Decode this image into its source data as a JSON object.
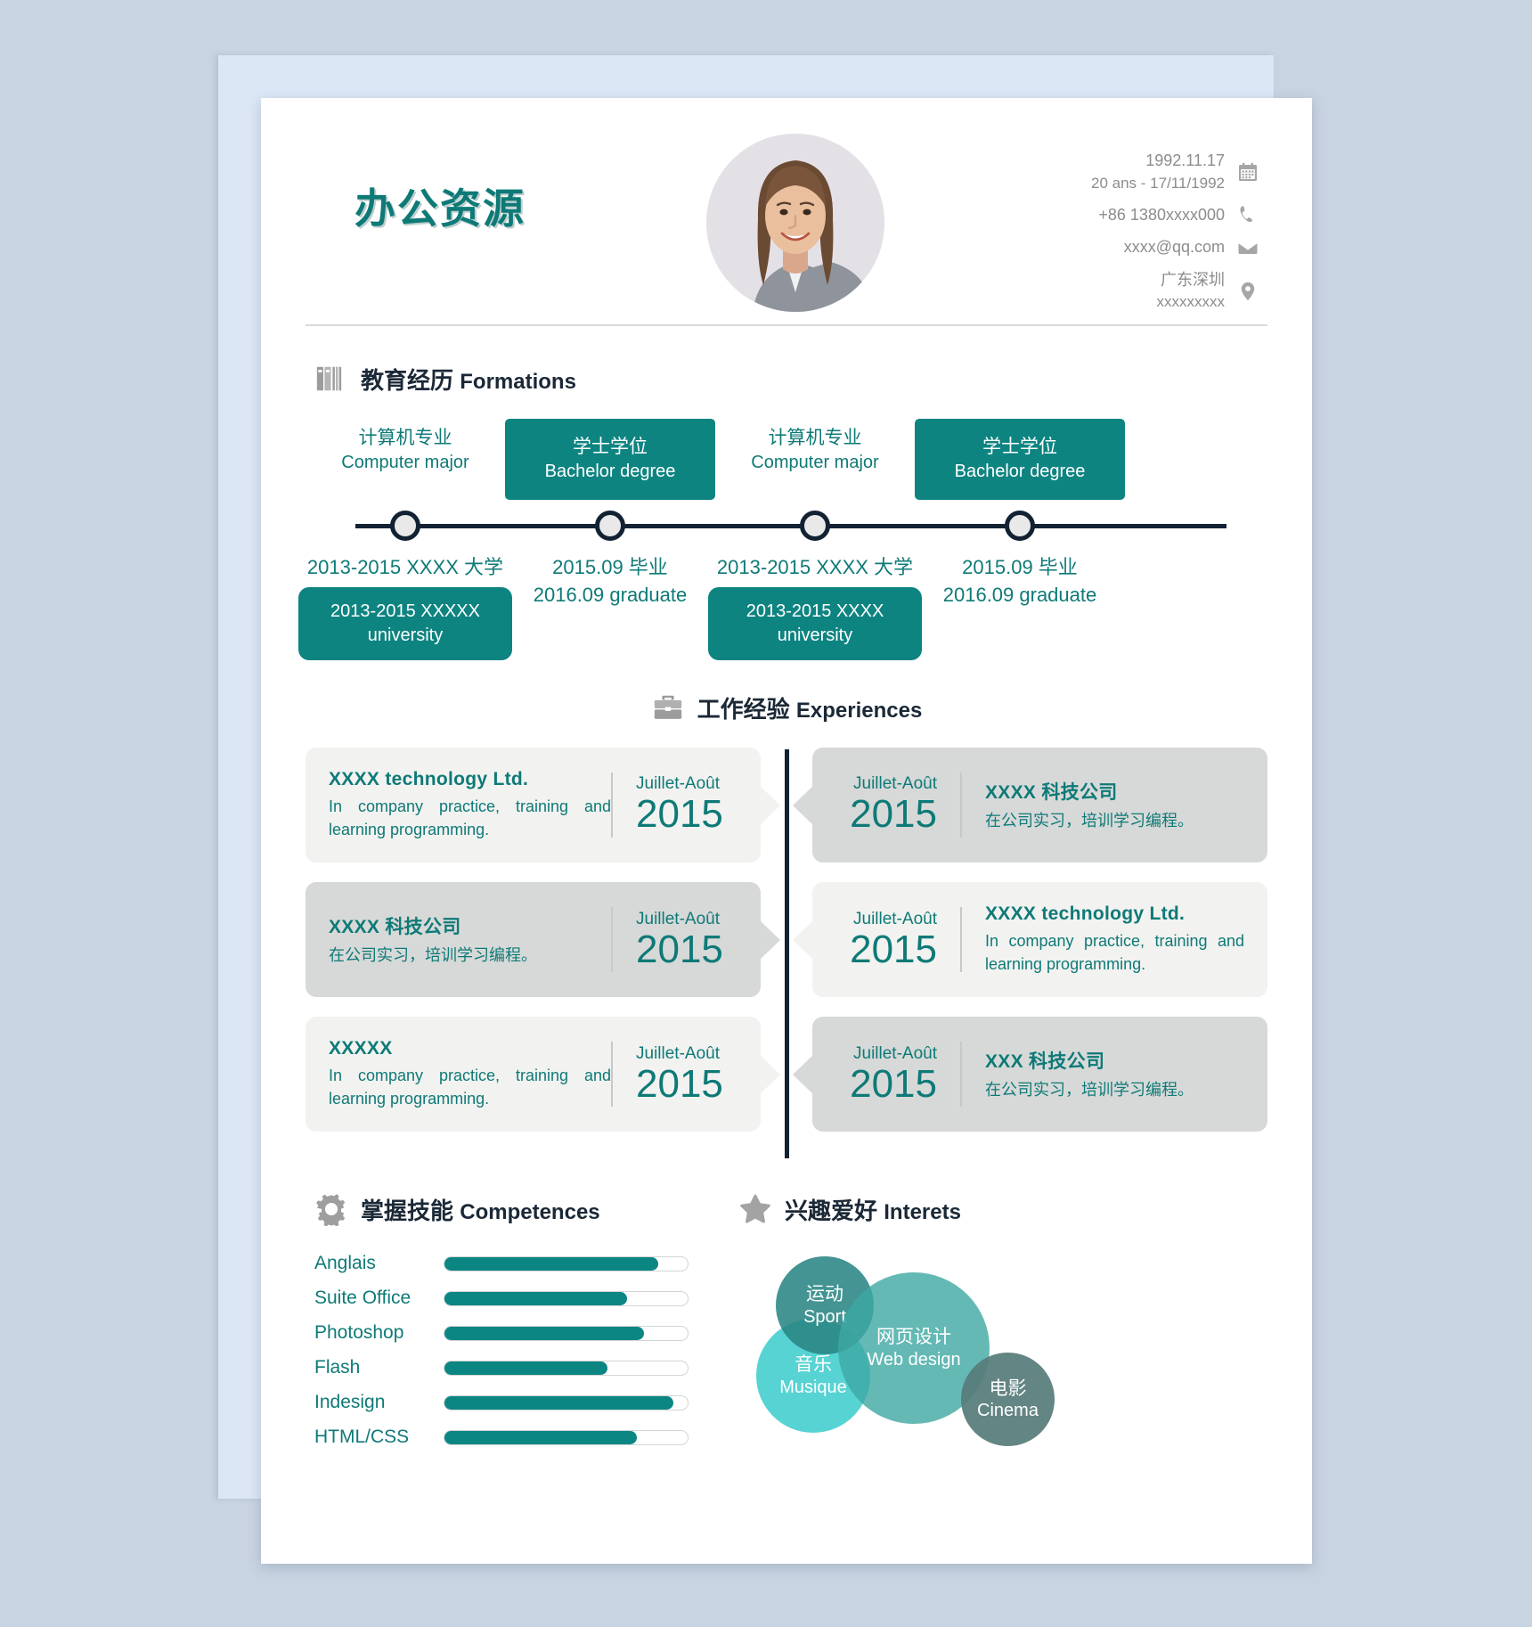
{
  "header": {
    "name": "办公资源",
    "contact": [
      {
        "icon": "calendar-icon",
        "line1": "1992.11.17",
        "line2": "20 ans - 17/11/1992"
      },
      {
        "icon": "phone-icon",
        "line1": "+86 1380xxxx000",
        "line2": ""
      },
      {
        "icon": "mail-icon",
        "line1": "xxxx@qq.com",
        "line2": ""
      },
      {
        "icon": "location-icon",
        "line1": "广东深圳",
        "line2": "xxxxxxxxx"
      }
    ]
  },
  "education": {
    "icon": "books-icon",
    "title_cn": "教育经历",
    "title_en": "Formations",
    "items": [
      {
        "top_cn": "计算机专业",
        "top_en": "Computer major",
        "boxed": false,
        "bot_line1": "2013-2015 XXXX 大学",
        "bot_line2": "",
        "pill": "2013-2015 XXXXX university"
      },
      {
        "top_cn": "学士学位",
        "top_en": "Bachelor degree",
        "boxed": true,
        "bot_line1": "2015.09 毕业",
        "bot_line2": "2016.09 graduate",
        "pill": ""
      },
      {
        "top_cn": "计算机专业",
        "top_en": "Computer major",
        "boxed": false,
        "bot_line1": "2013-2015 XXXX 大学",
        "bot_line2": "",
        "pill": "2013-2015 XXXX university"
      },
      {
        "top_cn": "学士学位",
        "top_en": "Bachelor degree",
        "boxed": true,
        "bot_line1": "2015.09 毕业",
        "bot_line2": "2016.09 graduate",
        "pill": ""
      }
    ]
  },
  "experience": {
    "icon": "briefcase-icon",
    "title_cn": "工作经验",
    "title_en": "Experiences",
    "rows": [
      {
        "left": {
          "title": "XXXX   technology Ltd.",
          "desc": "In company practice, training and learning programming.",
          "month": "Juillet-Août",
          "year": "2015",
          "tone": "light"
        },
        "right": {
          "title": "XXXX 科技公司",
          "desc": "在公司实习，培训学习编程。",
          "month": "Juillet-Août",
          "year": "2015",
          "tone": "dark"
        }
      },
      {
        "left": {
          "title": "XXXX 科技公司",
          "desc": "在公司实习，培训学习编程。",
          "month": "Juillet-Août",
          "year": "2015",
          "tone": "dark"
        },
        "right": {
          "title": "XXXX technology Ltd.",
          "desc": "In company practice, training and learning programming.",
          "month": "Juillet-Août",
          "year": "2015",
          "tone": "light"
        }
      },
      {
        "left": {
          "title": "XXXXX",
          "desc": "In company practice, training and learning programming.",
          "month": "Juillet-Août",
          "year": "2015",
          "tone": "light"
        },
        "right": {
          "title": "XXX 科技公司",
          "desc": "在公司实习，培训学习编程。",
          "month": "Juillet-Août",
          "year": "2015",
          "tone": "dark"
        }
      }
    ]
  },
  "skills": {
    "icon": "gear-icon",
    "title_cn": "掌握技能",
    "title_en": "Competences",
    "items": [
      {
        "label": "Anglais",
        "value": 88
      },
      {
        "label": "Suite Office",
        "value": 75
      },
      {
        "label": "Photoshop",
        "value": 82
      },
      {
        "label": "Flash",
        "value": 67
      },
      {
        "label": "Indesign",
        "value": 94
      },
      {
        "label": "HTML/CSS",
        "value": 79
      }
    ]
  },
  "interests": {
    "icon": "star-icon",
    "title_cn": "兴趣爱好",
    "title_en": "Interets",
    "bubbles": [
      {
        "cn": "运动",
        "en": "Sport",
        "color": "#298583"
      },
      {
        "cn": "网页设计",
        "en": "Web design",
        "color": "#3da8a3"
      },
      {
        "cn": "音乐",
        "en": "Musique",
        "color": "#40cdcd"
      },
      {
        "cn": "电影",
        "en": "Cinema",
        "color": "#567b79"
      }
    ]
  },
  "theme": {
    "accent": "#0e8481",
    "accent_text": "#0e7a77",
    "dark": "#122233",
    "page_bg": "#ffffff",
    "blue_sheet": "#dce7f6",
    "canvas_bg": "#c9d4e2"
  }
}
